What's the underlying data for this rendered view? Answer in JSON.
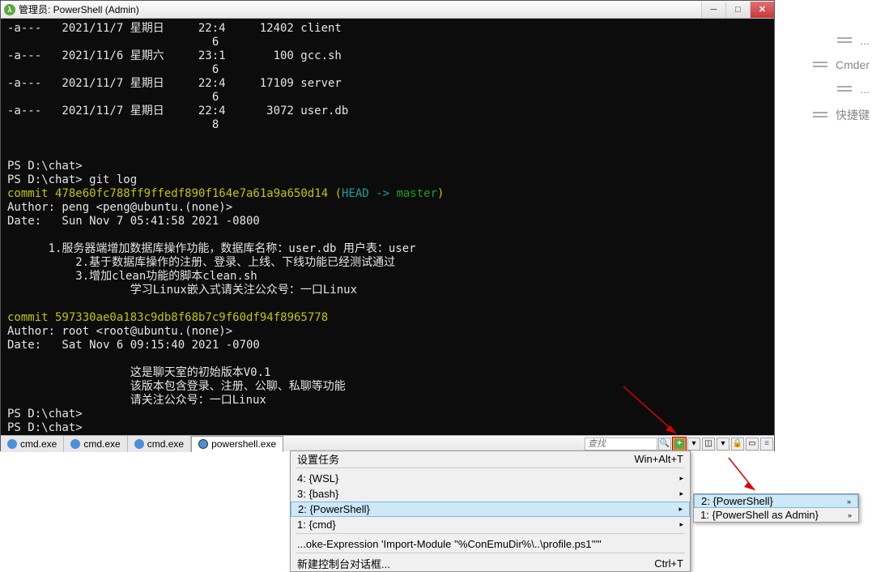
{
  "window": {
    "title": "管理员: PowerShell (Admin)"
  },
  "terminal": {
    "lines": [
      {
        "cls": "white",
        "t": "-a---   2021/11/7 星期日     22:4     12402 client"
      },
      {
        "cls": "white",
        "t": "                              6"
      },
      {
        "cls": "white",
        "t": "-a---   2021/11/6 星期六     23:1       100 gcc.sh"
      },
      {
        "cls": "white",
        "t": "                              6"
      },
      {
        "cls": "white",
        "t": "-a---   2021/11/7 星期日     22:4     17109 server"
      },
      {
        "cls": "white",
        "t": "                              6"
      },
      {
        "cls": "white",
        "t": "-a---   2021/11/7 星期日     22:4      3072 user.db"
      },
      {
        "cls": "white",
        "t": "                              8"
      },
      {
        "cls": "white",
        "t": ""
      },
      {
        "cls": "white",
        "t": ""
      },
      {
        "cls": "white",
        "t": "PS D:\\chat>"
      },
      {
        "cls": "white",
        "t": "PS D:\\chat> git log"
      },
      {
        "cls": "mix",
        "parts": [
          {
            "cls": "yellow",
            "t": "commit 478e60fc788ff9ffedf890f164e7a61a9a650d14 ("
          },
          {
            "cls": "cyan",
            "t": "HEAD -> "
          },
          {
            "cls": "green",
            "t": "master"
          },
          {
            "cls": "yellow",
            "t": ")"
          }
        ]
      },
      {
        "cls": "white",
        "t": "Author: peng <peng@ubuntu.(none)>"
      },
      {
        "cls": "white",
        "t": "Date:   Sun Nov 7 05:41:58 2021 -0800"
      },
      {
        "cls": "white",
        "t": ""
      },
      {
        "cls": "white",
        "t": "      1.服务器端增加数据库操作功能，数据库名称：user.db 用户表：user"
      },
      {
        "cls": "white",
        "t": "          2.基于数据库操作的注册、登录、上线、下线功能已经测试通过"
      },
      {
        "cls": "white",
        "t": "          3.增加clean功能的脚本clean.sh"
      },
      {
        "cls": "white",
        "t": "                  学习Linux嵌入式请关注公众号：一口Linux"
      },
      {
        "cls": "white",
        "t": ""
      },
      {
        "cls": "yellow",
        "t": "commit 597330ae0a183c9db8f68b7c9f60df94f8965778"
      },
      {
        "cls": "white",
        "t": "Author: root <root@ubuntu.(none)>"
      },
      {
        "cls": "white",
        "t": "Date:   Sat Nov 6 09:15:40 2021 -0700"
      },
      {
        "cls": "white",
        "t": ""
      },
      {
        "cls": "white",
        "t": "                  这是聊天室的初始版本V0.1"
      },
      {
        "cls": "white",
        "t": "                  该版本包含登录、注册、公聊、私聊等功能"
      },
      {
        "cls": "white",
        "t": "                  请关注公众号：一口Linux"
      },
      {
        "cls": "white",
        "t": "PS D:\\chat>"
      },
      {
        "cls": "white",
        "t": "PS D:\\chat>"
      }
    ]
  },
  "tabs": [
    {
      "label": "cmd.exe",
      "type": "cmd"
    },
    {
      "label": "cmd.exe",
      "type": "cmd"
    },
    {
      "label": "cmd.exe",
      "type": "cmd"
    },
    {
      "label": "powershell.exe",
      "type": "ps",
      "active": true
    }
  ],
  "search_placeholder": "查找",
  "menu1": {
    "header": {
      "label": "设置任务",
      "shortcut": "Win+Alt+T"
    },
    "items": [
      {
        "label": "4: {WSL}",
        "sub": true
      },
      {
        "label": "3: {bash}",
        "sub": true
      },
      {
        "label": "2: {PowerShell}",
        "sub": true,
        "sel": true
      },
      {
        "label": "1: {cmd}",
        "sub": true
      }
    ],
    "footer1": "...oke-Expression 'Import-Module ''%ConEmuDir%\\..\\profile.ps1'''\"",
    "footer2": {
      "label": "新建控制台对话框...",
      "shortcut": "Ctrl+T"
    }
  },
  "menu2": {
    "items": [
      {
        "label": "2: {PowerShell}",
        "sel": true
      },
      {
        "label": "1: {PowerShell as Admin}"
      }
    ]
  },
  "right_sidebar": [
    "Cmder",
    "快捷键"
  ]
}
